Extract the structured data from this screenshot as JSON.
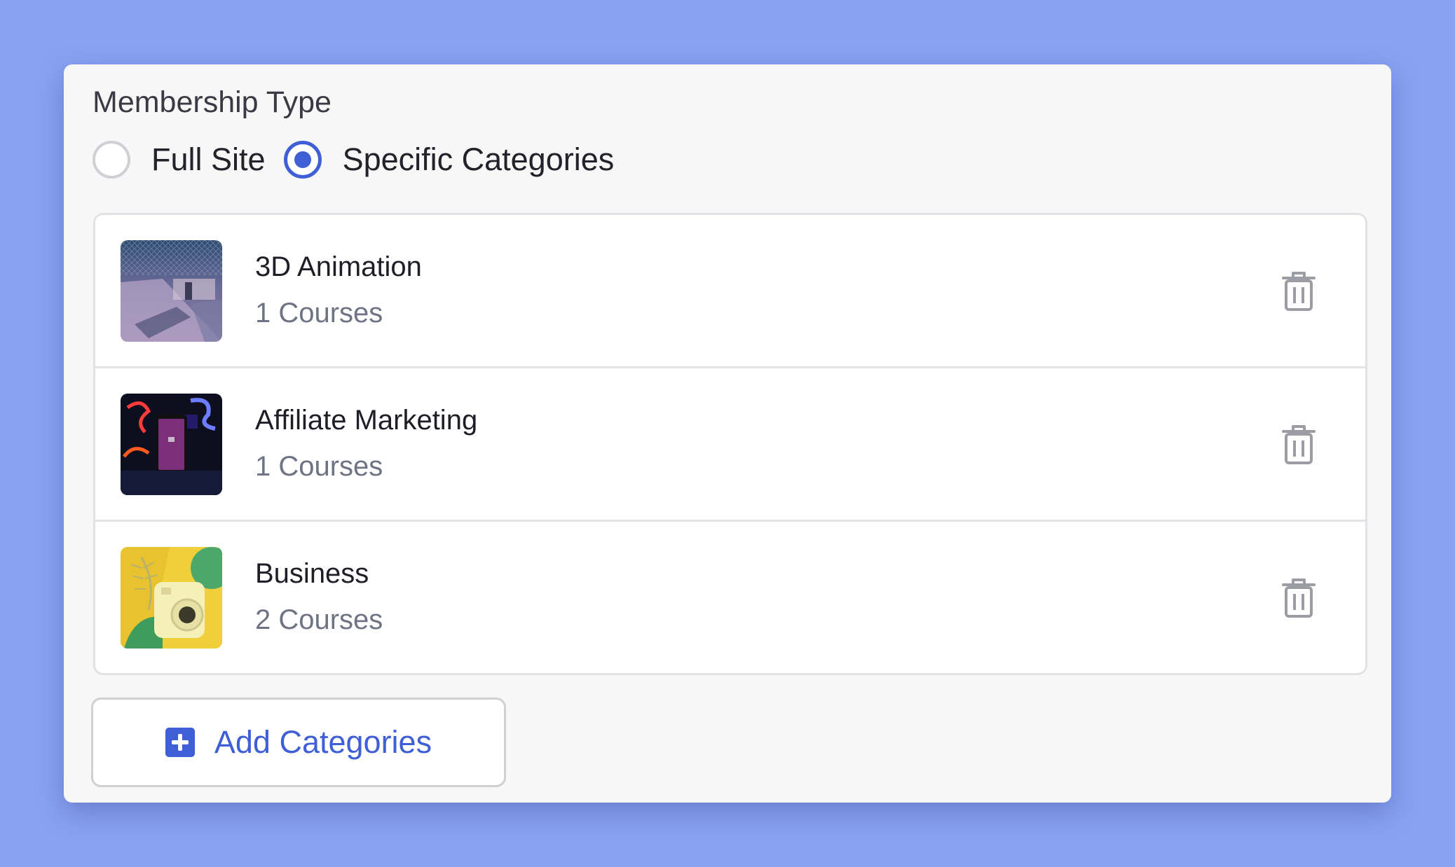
{
  "membership": {
    "title": "Membership Type",
    "options": [
      {
        "label": "Full Site",
        "selected": false
      },
      {
        "label": "Specific Categories",
        "selected": true
      }
    ]
  },
  "categories": [
    {
      "name": "3D Animation",
      "count": "1 Courses",
      "thumb_icon": "3d-animation-thumbnail"
    },
    {
      "name": "Affiliate Marketing",
      "count": "1 Courses",
      "thumb_icon": "affiliate-marketing-thumbnail"
    },
    {
      "name": "Business",
      "count": "2 Courses",
      "thumb_icon": "business-thumbnail"
    }
  ],
  "actions": {
    "add_label": "Add Categories"
  },
  "colors": {
    "accent": "#3f5fd6",
    "background": "#8aa2f2",
    "panel": "#f7f7f7"
  }
}
